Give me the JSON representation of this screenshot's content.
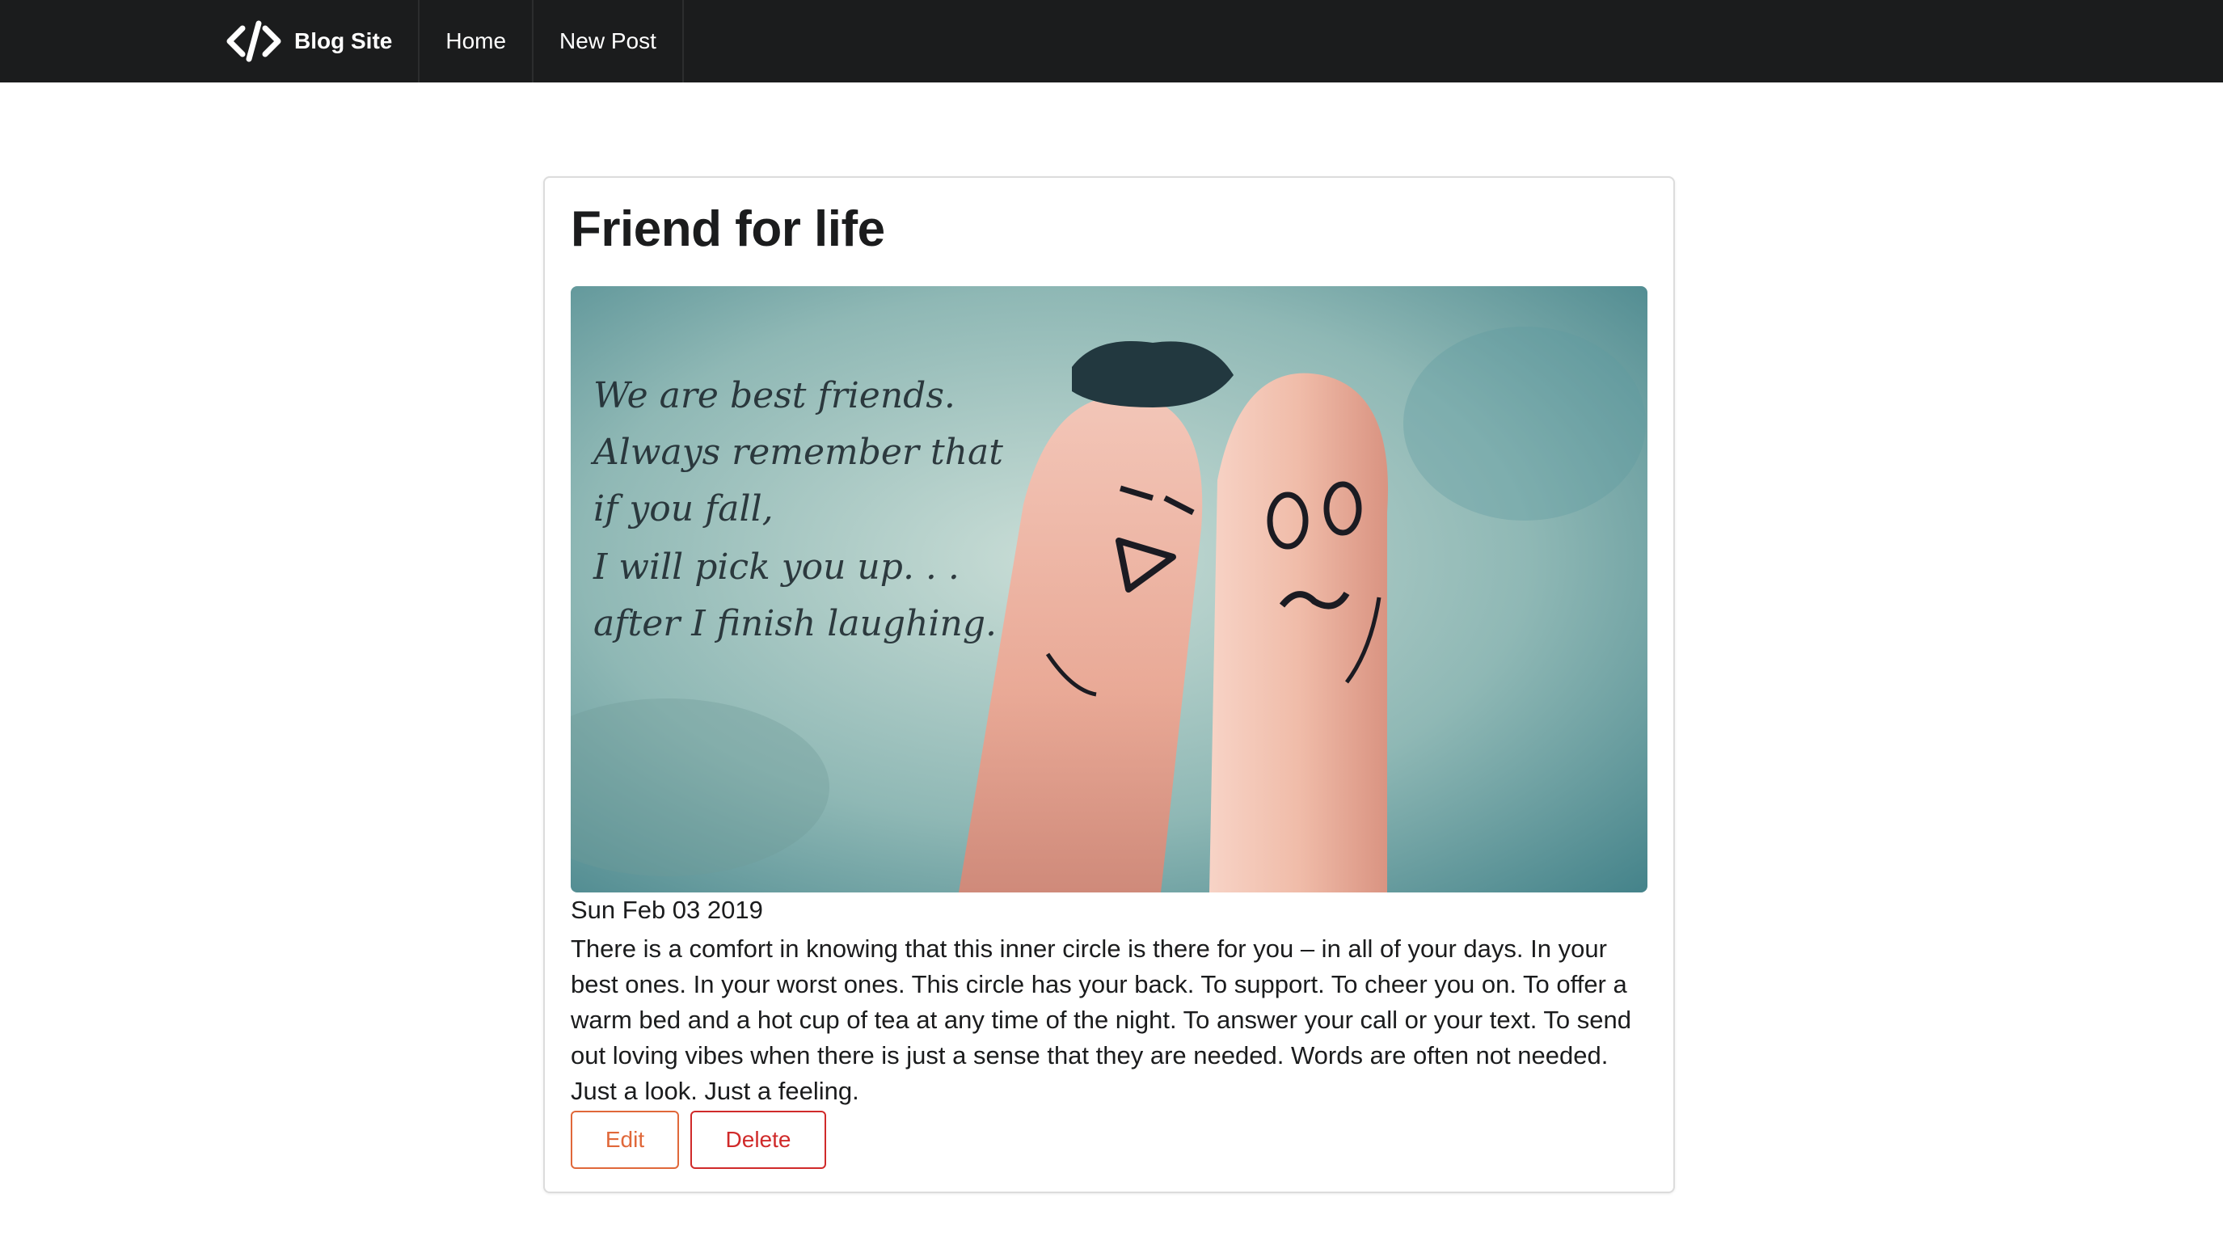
{
  "navbar": {
    "brand_label": "Blog Site",
    "logo_icon": "code-icon",
    "items": [
      {
        "label": "Home"
      },
      {
        "label": "New Post"
      }
    ]
  },
  "post": {
    "title": "Friend for life",
    "image": {
      "description_icon": "fingers-friends-image",
      "quote_lines": [
        "We are best friends.",
        "Always remember that",
        "if you fall,",
        "I will pick you up. . .",
        "after I finish laughing."
      ]
    },
    "date": "Sun Feb 03 2019",
    "body": "There is a comfort in knowing that this inner circle is there for you – in all of your days. In your best ones. In your worst ones. This circle has your back. To support. To cheer you on. To offer a warm bed and a hot cup of tea at any time of the night. To answer your call or your text. To send out loving vibes when there is just a sense that they are needed. Words are often not needed. Just a look. Just a feeling.",
    "edit_label": "Edit",
    "delete_label": "Delete"
  },
  "colors": {
    "navbar_bg": "#1b1c1d",
    "edit_accent": "#e0683a",
    "delete_accent": "#d02a2a"
  }
}
